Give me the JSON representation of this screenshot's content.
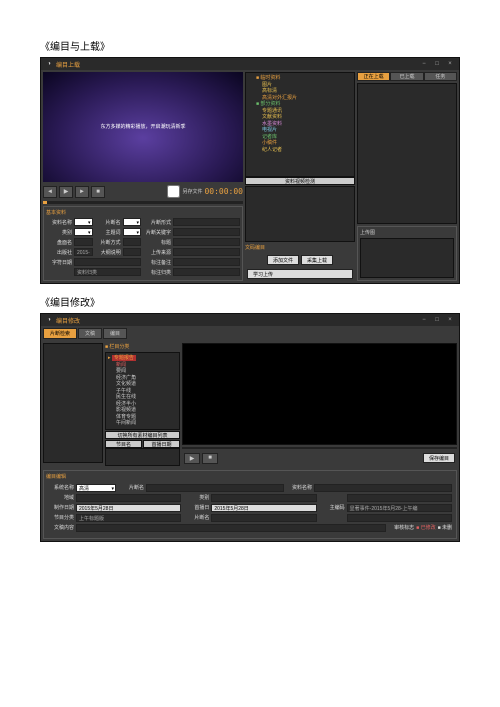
{
  "doc": {
    "caption1": "《编目与上载》",
    "caption2": "《编目修改》"
  },
  "w1": {
    "title": "编目上载",
    "video_text": "东方多媒的精彩播放，开启潮玩清新季",
    "audio_label": "另存文件",
    "time": "00:00:00",
    "upload_btn": "采集上载",
    "add_btn": "添加文件",
    "tree": {
      "root1": "临时资料",
      "r1c": [
        "图片",
        "高标清",
        "高清对外汇报片"
      ],
      "root2": "部分资料",
      "r2c": [
        "专题通讯",
        "文献资料",
        "水墨资料",
        "电视片",
        "记者库",
        "小稿件",
        "纪人记者"
      ],
      "cap_top": "资料视频检测"
    },
    "meta_title": "文码编目",
    "tabs": [
      "正在上载",
      "已上载",
      "任务"
    ],
    "img_panel": "上传图",
    "form": {
      "r1": [
        "资料名称",
        "",
        "片断名",
        "",
        "",
        "片断形式",
        "",
        "片断时码",
        ""
      ],
      "r2": [
        "类别",
        "",
        "主题词",
        "",
        "",
        "片断关键字",
        "",
        ""
      ],
      "r3": [
        "盘面名",
        "",
        "片断方式",
        " ",
        "",
        "标题",
        ""
      ],
      "r4": [
        "出版社",
        "2015-5-26",
        "大纲说明",
        "",
        "",
        "上传来源",
        ""
      ],
      "r5": [
        "字符日期",
        "",
        "",
        "",
        "",
        "",
        "标注备注",
        ""
      ],
      "r6": [
        "",
        "",
        "资料归类",
        "",
        "",
        "",
        "标注归类",
        ""
      ]
    },
    "basic_panel": "基本资料"
  },
  "w2": {
    "title": "编目修改",
    "tabs": [
      "片断检索",
      "文稿",
      "编目"
    ],
    "tree_title": "栏目分类",
    "tree": [
      "专题报告",
      "新闻",
      "要闻",
      "经济广角",
      "文化频道",
      "子午线",
      "民生在线",
      "经济半小",
      "影视频道",
      "体育专题",
      "午间新闻"
    ],
    "cap_label": "切换所有素材编目列表",
    "col_labels": [
      "节目名",
      "首播日期"
    ],
    "save_btn": "保存编目",
    "lower_title": "编目编辑",
    "form": {
      "r1": [
        "系统名称",
        "高清",
        "片断名",
        "",
        "",
        "资料名称",
        ""
      ],
      "r2": [
        "地域",
        "",
        "",
        "类别",
        "",
        "",
        ""
      ],
      "r3": [
        "制作日期",
        "2015年5月28日",
        "首播日",
        "2015年5月28日",
        "主编码",
        "显著事件-2015年5月28-上午编"
      ],
      "r4": [
        "节目分类",
        "上午标题版",
        "片断名",
        "",
        "",
        ""
      ],
      "r5": [
        "文稿内容",
        "",
        "",
        "",
        "审核标志",
        "■ 已修改",
        "■ 未删"
      ]
    }
  }
}
